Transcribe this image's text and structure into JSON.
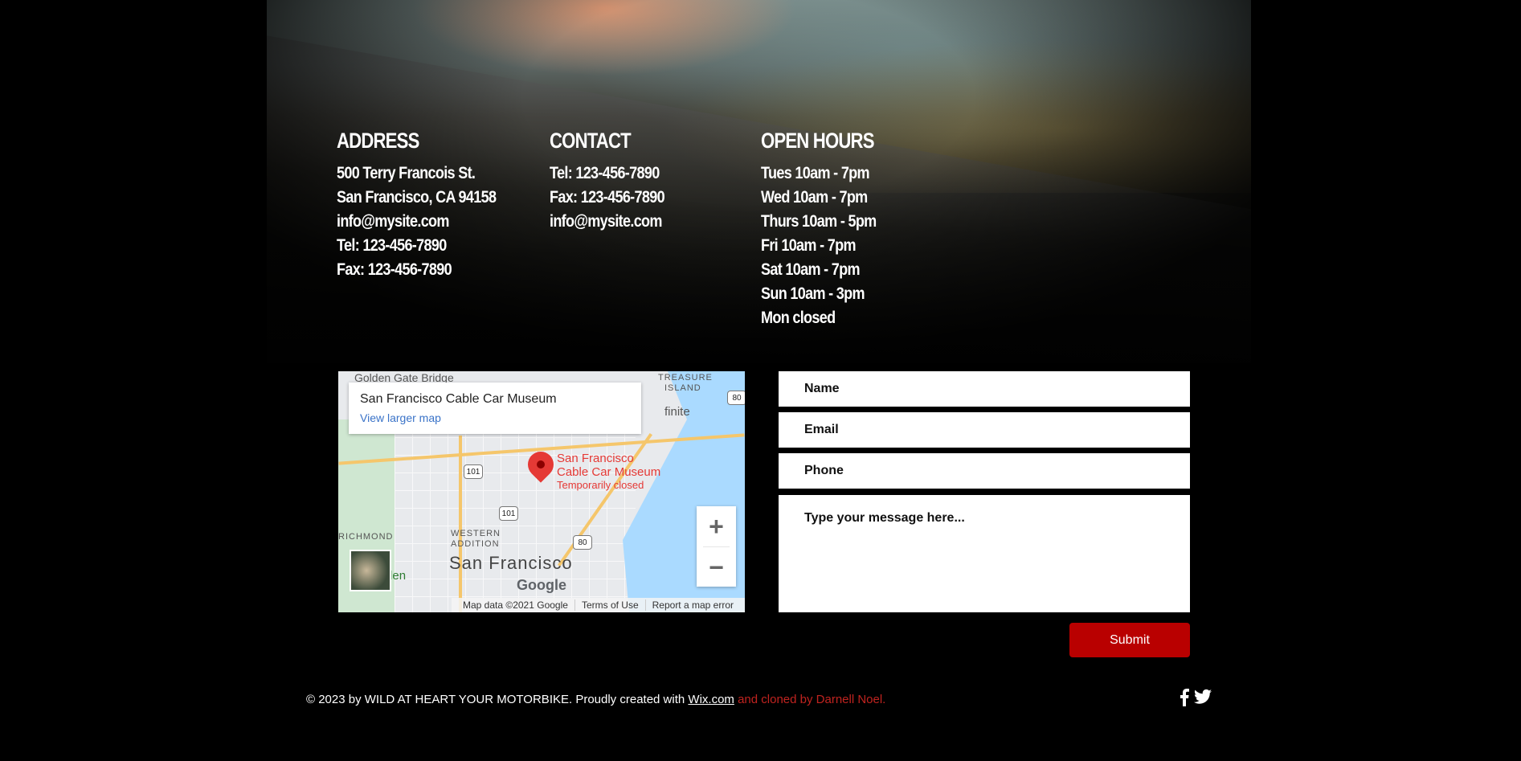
{
  "colors": {
    "background": "#000000",
    "accent": "#b90000",
    "credit": "#c0231f"
  },
  "address": {
    "heading": "ADDRESS",
    "lines": [
      "500 Terry Francois St.",
      "San Francisco, CA 94158",
      "info@mysite.com",
      "Tel: 123-456-7890",
      "Fax: 123-456-7890"
    ]
  },
  "contact": {
    "heading": "CONTACT",
    "lines": [
      "Tel: 123-456-7890",
      "Fax: 123-456-7890",
      "info@mysite.com"
    ]
  },
  "hours": {
    "heading": "OPEN HOURS",
    "lines": [
      "Tues 10am - 7pm",
      "Wed 10am - 7pm",
      "Thurs 10am - 5pm",
      "Fri 10am - 7pm",
      "Sat 10am - 7pm",
      "Sun 10am - 3pm",
      "Mon closed"
    ]
  },
  "map": {
    "place_title": "San Francisco Cable Car Museum",
    "larger_map_link": "View larger map",
    "poi_name_line1": "San Francisco",
    "poi_name_line2": "Cable Car Museum",
    "poi_status": "Temporarily closed",
    "city_label": "San Francisco",
    "district_richmond": "RICHMOND",
    "district_western": "WESTERN",
    "district_addition": "ADDITION",
    "district_treasure": "TREASURE",
    "district_island": "ISLAND",
    "area_infinite": "finite",
    "top_label": "Golden Gate Bridge",
    "park_label": "Garden",
    "highway_101a": "101",
    "highway_101b": "101",
    "highway_80a": "80",
    "highway_80b": "80",
    "zoom_in": "+",
    "zoom_out": "−",
    "logo": "Google",
    "attribution": "Map data ©2021 Google",
    "terms": "Terms of Use",
    "report": "Report a map error"
  },
  "form": {
    "name_placeholder": "Name",
    "email_placeholder": "Email",
    "phone_placeholder": "Phone",
    "message_placeholder": "Type your message here...",
    "submit_label": "Submit"
  },
  "footer": {
    "copyright": "© 2023 by WILD AT HEART YOUR MOTORBIKE. Proudly created with ",
    "wix_link": "Wix.com",
    "credit": " and cloned by Darnell Noel."
  },
  "social": [
    "facebook-icon",
    "twitter-icon"
  ]
}
